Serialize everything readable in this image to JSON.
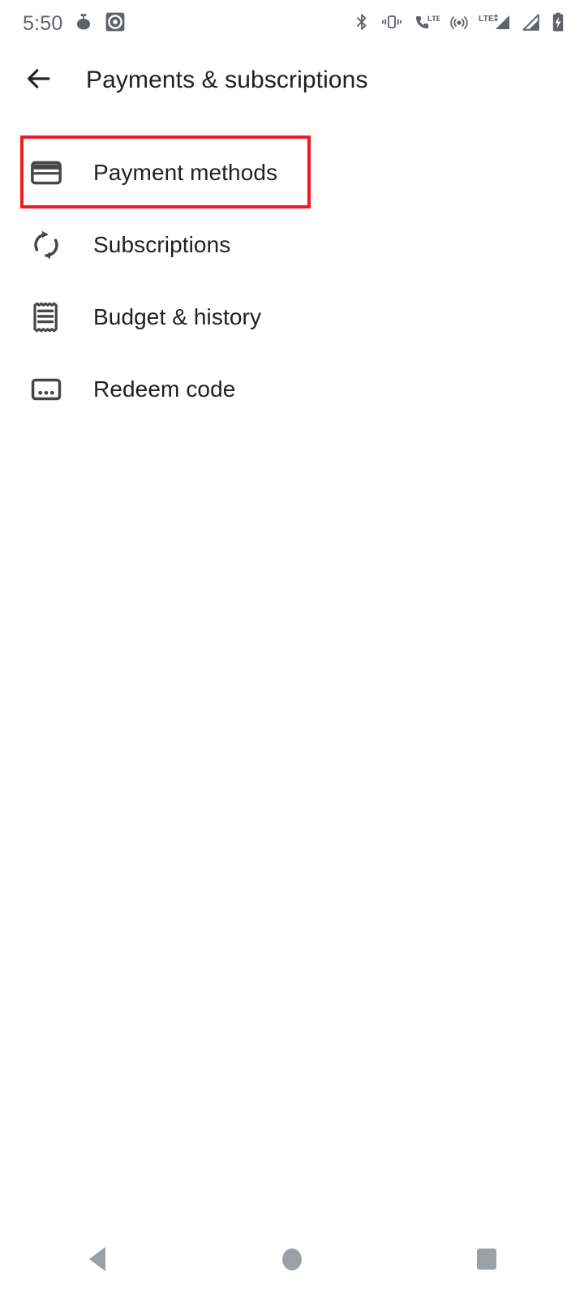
{
  "status_bar": {
    "clock": "5:50",
    "notification_icons": [
      "app-notification-icon",
      "media-disc-icon"
    ],
    "system_icons": [
      "bluetooth-icon",
      "vibrate-icon",
      "volte-call-icon",
      "hotspot-icon",
      "lte-data-icon",
      "signal-bars-icon",
      "signal-bars-secondary-icon",
      "battery-charging-icon"
    ]
  },
  "app_bar": {
    "back_icon": "arrow-back-icon",
    "title": "Payments & subscriptions"
  },
  "list": {
    "items": [
      {
        "label": "Payment methods",
        "icon": "credit-card-icon"
      },
      {
        "label": "Subscriptions",
        "icon": "autorenew-icon"
      },
      {
        "label": "Budget & history",
        "icon": "receipt-icon"
      },
      {
        "label": "Redeem code",
        "icon": "redeem-code-icon"
      }
    ]
  },
  "annotation": {
    "type": "highlight-rectangle",
    "target": "Payment methods",
    "color": "#ee1b24"
  },
  "nav_bar": {
    "buttons": [
      {
        "name": "back",
        "icon": "nav-back-triangle-icon"
      },
      {
        "name": "home",
        "icon": "nav-home-circle-icon"
      },
      {
        "name": "recents",
        "icon": "nav-recents-square-icon"
      }
    ]
  },
  "colors": {
    "background": "#ffffff",
    "text_primary": "#202124",
    "text_secondary": "#5f6368",
    "icon": "#444746",
    "nav_icon": "#9aa0a6",
    "highlight": "#ee1b24"
  }
}
